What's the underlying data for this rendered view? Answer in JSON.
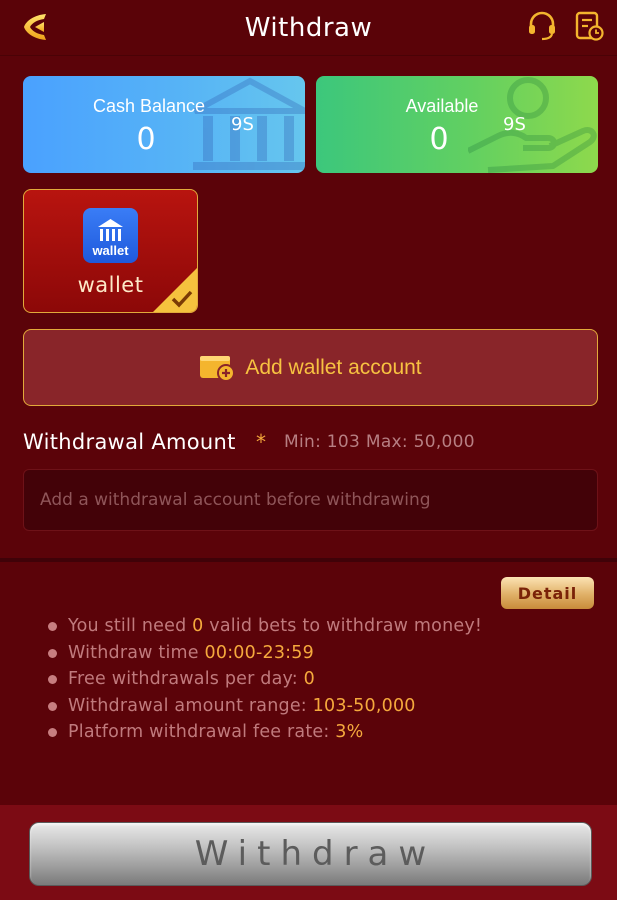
{
  "header": {
    "title": "Withdraw",
    "back_icon": "back-arrow-icon",
    "support_icon": "headset-icon",
    "history_icon": "history-record-icon"
  },
  "balances": {
    "cash": {
      "label": "Cash Balance",
      "value": "0",
      "unit": "9S"
    },
    "available": {
      "label": "Available",
      "value": "0",
      "unit": "9S"
    }
  },
  "method": {
    "label": "wallet",
    "icon_text": "wallet",
    "selected": true
  },
  "add_wallet": {
    "label": "Add wallet account"
  },
  "amount": {
    "title": "Withdrawal Amount",
    "required_mark": "*",
    "limits": "Min: 103 Max: 50,000",
    "placeholder": "Add a withdrawal account before withdrawing"
  },
  "rules": {
    "detail_label": "Detail",
    "items": [
      {
        "pre": "You still need ",
        "hl": "0",
        "post": " valid bets to withdraw money!"
      },
      {
        "pre": "Withdraw time ",
        "hl": "00:00-23:59",
        "post": ""
      },
      {
        "pre": "Free withdrawals per day: ",
        "hl": "0",
        "post": ""
      },
      {
        "pre": "Withdrawal amount range: ",
        "hl": "103-50,000",
        "post": ""
      },
      {
        "pre": "Platform withdrawal fee rate: ",
        "hl": "3%",
        "post": ""
      }
    ]
  },
  "submit": {
    "label": "Withdraw"
  },
  "colors": {
    "background": "#5b0309",
    "accent_gold": "#f5a93d",
    "card_border": "#e2aa3a"
  }
}
